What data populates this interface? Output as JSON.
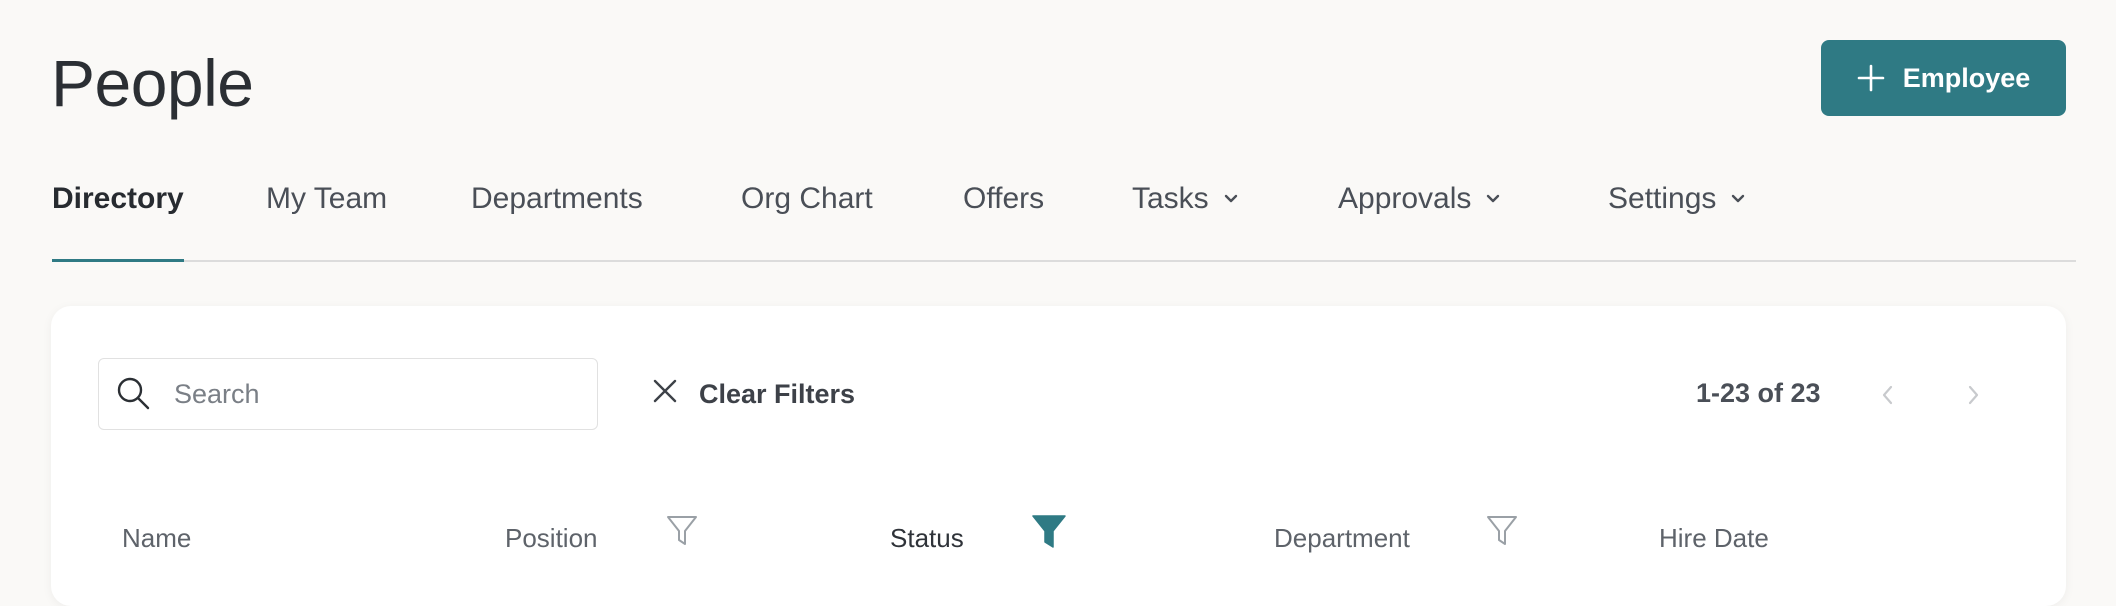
{
  "header": {
    "title": "People",
    "add_button_label": "Employee",
    "add_icon": "plus-icon"
  },
  "tabs": [
    {
      "label": "Directory",
      "active": true,
      "has_dropdown": false
    },
    {
      "label": "My Team",
      "active": false,
      "has_dropdown": false
    },
    {
      "label": "Departments",
      "active": false,
      "has_dropdown": false
    },
    {
      "label": "Org Chart",
      "active": false,
      "has_dropdown": false
    },
    {
      "label": "Offers",
      "active": false,
      "has_dropdown": false
    },
    {
      "label": "Tasks",
      "active": false,
      "has_dropdown": true
    },
    {
      "label": "Approvals",
      "active": false,
      "has_dropdown": true
    },
    {
      "label": "Settings",
      "active": false,
      "has_dropdown": true
    }
  ],
  "toolbar": {
    "search_placeholder": "Search",
    "search_value": "",
    "clear_filters_label": "Clear Filters",
    "pagination_text": "1-23 of 23"
  },
  "table": {
    "columns": [
      {
        "label": "Name",
        "filterable": false,
        "filter_active": false
      },
      {
        "label": "Position",
        "filterable": true,
        "filter_active": false
      },
      {
        "label": "Status",
        "filterable": true,
        "filter_active": true
      },
      {
        "label": "Department",
        "filterable": true,
        "filter_active": false
      },
      {
        "label": "Hire Date",
        "filterable": false,
        "filter_active": false
      }
    ]
  },
  "colors": {
    "accent": "#2f7a84",
    "background": "#faf9f7",
    "card": "#ffffff"
  }
}
